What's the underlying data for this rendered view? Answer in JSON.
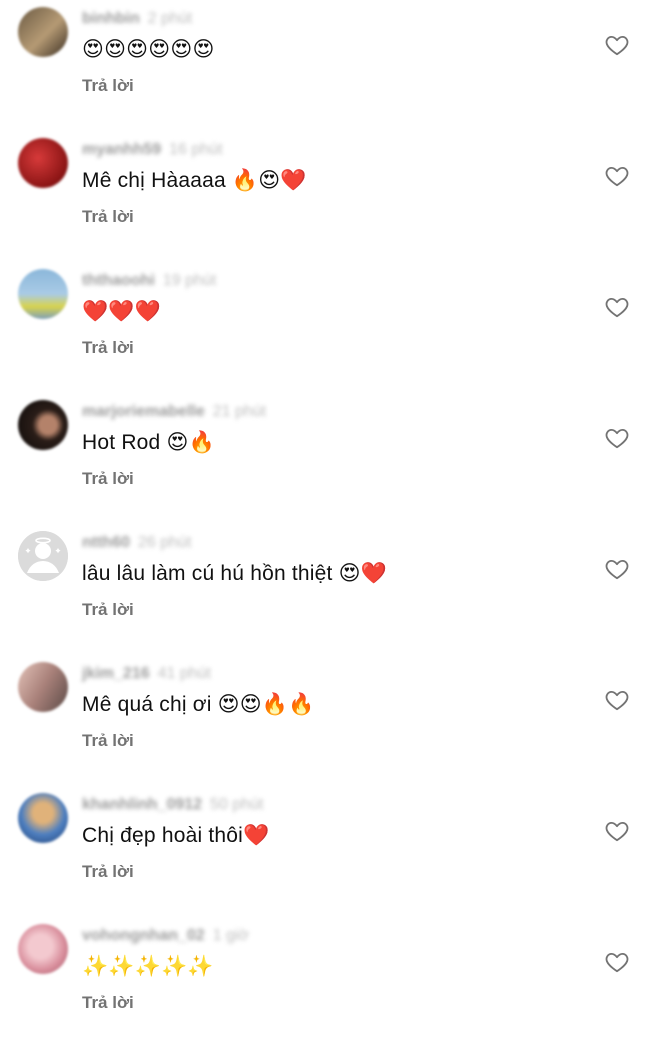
{
  "reply_label": "Trả lời",
  "comments": [
    {
      "username": "binhbin",
      "time": "2 phút",
      "text": "😍😍😍😍😍😍",
      "avatar_bg": "linear-gradient(135deg,#6b5a43,#b59a74 55%,#3a2e22)"
    },
    {
      "username": "myanhh59",
      "time": "16 phút",
      "text": "Mê chị Hàaaaa 🔥😍❤️",
      "avatar_bg": "radial-gradient(circle at 40% 40%,#d73a3a,#8a1414 70%,#4a0a0a)"
    },
    {
      "username": "ththaoohi",
      "time": "19 phút",
      "text": "❤️❤️❤️",
      "avatar_bg": "linear-gradient(180deg,#8bb7da 0%,#a9cbe6 50%,#d8d34e 75%,#7fa0b8 100%)"
    },
    {
      "username": "marjoriemabelle",
      "time": "21 phút",
      "text": "Hot Rod 😍🔥",
      "avatar_bg": "radial-gradient(circle at 60% 50%,#b4826a 0 22%,#2a1d18 40%,#0d0a09 100%)"
    },
    {
      "username": "ntth60",
      "time": "26 phút",
      "text": "lâu lâu làm cú hú hồn thiệt 😍❤️",
      "avatar_bg": "#dbdbdb"
    },
    {
      "username": "jkim_216",
      "time": "41 phút",
      "text": "Mê quá chị ơi 😍😍🔥🔥",
      "avatar_bg": "linear-gradient(120deg,#e3c2b8,#a9817a 50%,#5b4a46)"
    },
    {
      "username": "khanhlinh_0912",
      "time": "50 phút",
      "text": "Chị đẹp hoài thôi❤️",
      "avatar_bg": "radial-gradient(circle at 50% 40%,#e0b27a 0 25%,#4e7fc0 55%,#1f3f73 100%)"
    },
    {
      "username": "vohongnhan_02",
      "time": "1 giờ",
      "text": "✨✨✨✨✨",
      "avatar_bg": "radial-gradient(circle at 45% 45%,#f3c9cf 0 30%,#d98f9d 60%,#a25766 100%)"
    }
  ],
  "icons": {
    "heart": "heart-outline-icon",
    "default_avatar": "default-profile-icon"
  },
  "colors": {
    "text": "#111111",
    "secondary": "#737373",
    "meta": "#8e8e8e",
    "heart_stroke": "#737373"
  }
}
